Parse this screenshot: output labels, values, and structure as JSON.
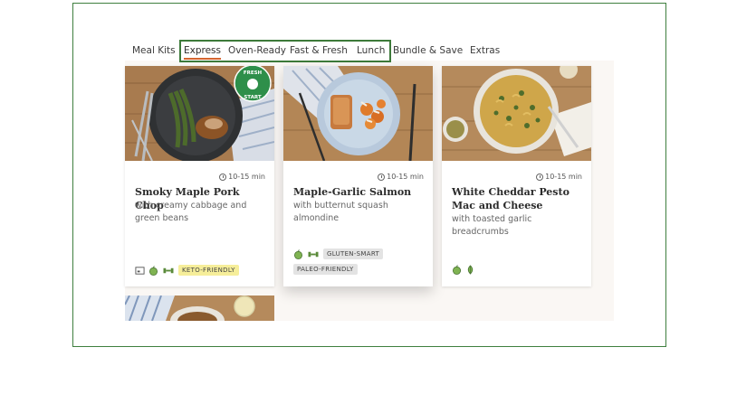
{
  "nav": {
    "items": [
      {
        "label": "Meal Kits",
        "active": false
      },
      {
        "label": "Express",
        "active": true
      },
      {
        "label": "Oven-Ready",
        "active": false
      },
      {
        "label": "Fast & Fresh",
        "active": false
      },
      {
        "label": "Lunch",
        "active": false
      },
      {
        "label": "Bundle & Save",
        "active": false
      },
      {
        "label": "Extras",
        "active": false
      }
    ]
  },
  "cards": [
    {
      "time": "10-15 min",
      "title": "Smoky Maple Pork Chop",
      "subtitle": "with creamy cabbage and green beans",
      "badge": "FRESH START",
      "icons": [
        "calories-icon",
        "apple-icon",
        "dumbbell-icon"
      ],
      "tags": [
        "KETO-FRIENDLY"
      ]
    },
    {
      "time": "10-15 min",
      "title": "Maple-Garlic Salmon",
      "subtitle": "with butternut squash almondine",
      "icons": [
        "apple-icon",
        "dumbbell-icon"
      ],
      "tags": [
        "GLUTEN-SMART",
        "PALEO-FRIENDLY"
      ]
    },
    {
      "time": "10-15 min",
      "title": "White Cheddar Pesto Mac and Cheese",
      "subtitle": "with toasted garlic breadcrumbs",
      "icons": [
        "apple-icon",
        "leaf-icon"
      ],
      "tags": []
    }
  ],
  "colors": {
    "accent_underline": "#d4652f",
    "highlight_border": "#3d7a3a",
    "keto_badge": "#f6ee9a",
    "grey_badge": "#e3e3e3"
  }
}
